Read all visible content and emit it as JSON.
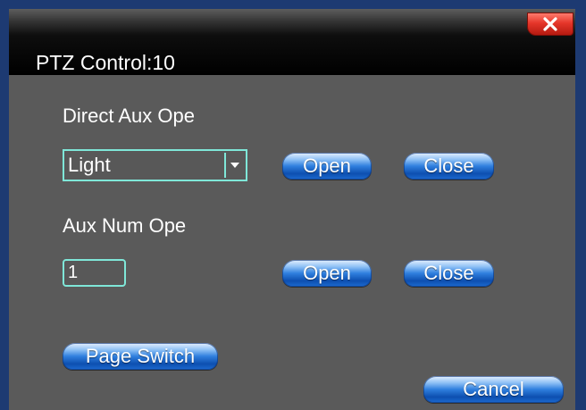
{
  "dialog": {
    "title": "PTZ Control:10",
    "close_icon": "close-x-icon"
  },
  "direct_aux": {
    "label": "Direct Aux Ope",
    "select_value": "Light",
    "open_label": "Open",
    "close_label": "Close"
  },
  "aux_num": {
    "label": "Aux Num Ope",
    "input_value": "1",
    "open_label": "Open",
    "close_label": "Close"
  },
  "footer": {
    "page_switch_label": "Page Switch",
    "cancel_label": "Cancel"
  },
  "colors": {
    "panel": "#5a5a5a",
    "field_border": "#7fe7d8",
    "button_blue": "#2f7fde",
    "close_red": "#e5362a"
  }
}
